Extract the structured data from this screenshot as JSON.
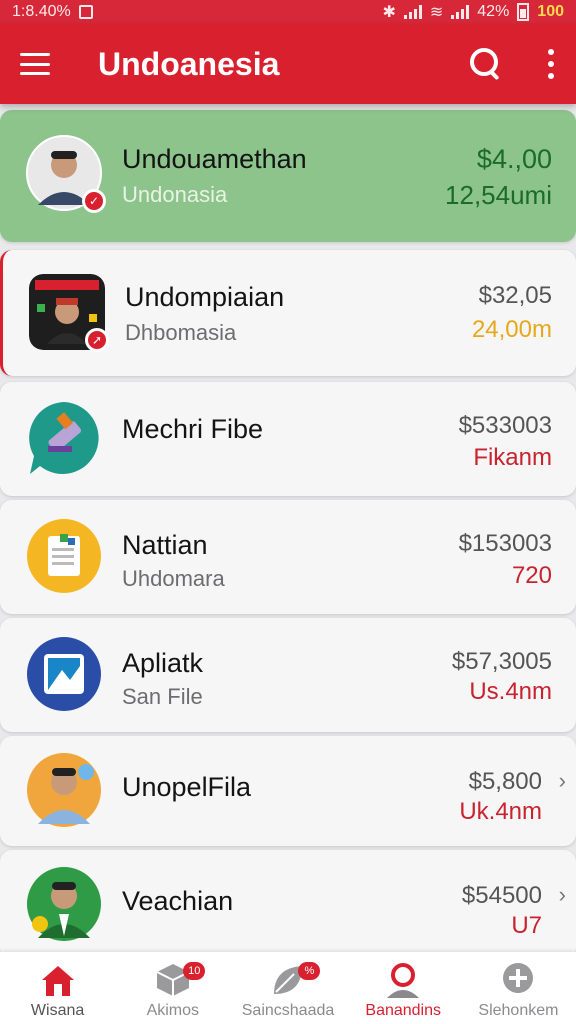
{
  "status_bar": {
    "time": "1:8.40%",
    "battery": "42%",
    "right_value": "100"
  },
  "app_bar": {
    "title": "Undoanesia",
    "menu_icon": "hamburger-menu-icon",
    "search_icon": "search-icon",
    "more_icon": "more-vertical-icon"
  },
  "colors": {
    "brand_red": "#d9202f",
    "highlight_green": "#8dc48b",
    "amount_red": "#c8232f",
    "amount_yellow": "#e7a81b",
    "amount_green": "#1b6b2b"
  },
  "list": [
    {
      "name": "Undouamethan",
      "sub": "Undonasia",
      "price": "$4.,00",
      "amount": "12,54umi",
      "amount_color": "#1b6b2b",
      "avatar": "person-avatar",
      "badge": "check-badge-icon"
    },
    {
      "name": "Undompiaian",
      "sub": "Dhbomasia",
      "price": "$32,05",
      "amount": "24,00m",
      "amount_color": "#e7a81b",
      "avatar": "app-thumbnail",
      "badge": "arrow-badge-icon"
    },
    {
      "name": "Mechri Fibe",
      "sub": "",
      "price": "$533003",
      "amount": "Fikanm",
      "amount_color": "#c8232f",
      "avatar": "chat-pencil-icon"
    },
    {
      "name": "Nattian",
      "sub": "Uhdomara",
      "price": "$153003",
      "amount": "720",
      "amount_color": "#c8232f",
      "avatar": "document-icon"
    },
    {
      "name": "Apliatk",
      "sub": "San File",
      "price": "$57,3005",
      "amount": "Us.4nm",
      "amount_color": "#c8232f",
      "avatar": "image-app-icon"
    },
    {
      "name": "UnopelFila",
      "sub": "",
      "price": "$5,800",
      "amount": "Uk.4nm",
      "amount_color": "#c8232f",
      "avatar": "person-avatar",
      "chevron": "›"
    },
    {
      "name": "Veachian",
      "sub": "",
      "price": "$54500",
      "amount": "U7",
      "amount_color": "#c8232f",
      "avatar": "person-avatar",
      "chevron": "›"
    }
  ],
  "bottom_nav": [
    {
      "label": "Wisana",
      "icon": "home-icon",
      "count": ""
    },
    {
      "label": "Akimos",
      "icon": "cube-icon",
      "count": "10"
    },
    {
      "label": "Saincshaada",
      "icon": "leaf-icon",
      "count": "%"
    },
    {
      "label": "Banandins",
      "icon": "person-icon",
      "count": ""
    },
    {
      "label": "Slehonkem",
      "icon": "plus-circle-icon",
      "count": ""
    }
  ]
}
